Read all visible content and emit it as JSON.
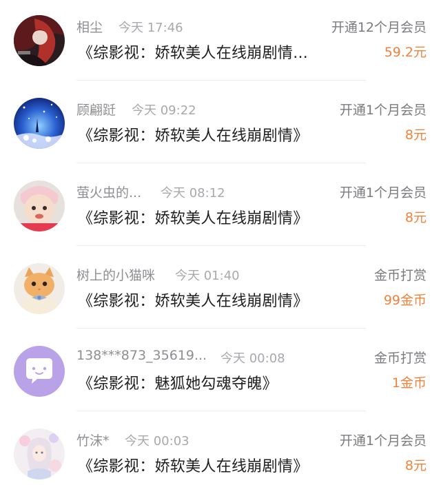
{
  "records": [
    {
      "user": "相尘",
      "time": "今天 17:46",
      "type": "开通12个月会员",
      "work": "《综影视：娇软美人在线崩剧情...",
      "amount": "59.2元",
      "avatar_icon": "dark-red-hair-anime-avatar"
    },
    {
      "user": "顾翩跹",
      "time": "今天 09:22",
      "type": "开通1个月会员",
      "work": "《综影视：娇软美人在线崩剧情》",
      "amount": "8元",
      "avatar_icon": "blue-starry-night-avatar"
    },
    {
      "user": "萤火虫的...",
      "time": "今天 08:12",
      "type": "开通1个月会员",
      "work": "《综影视：娇软美人在线崩剧情》",
      "amount": "8元",
      "avatar_icon": "baby-photo-avatar"
    },
    {
      "user": "树上的小猫咪",
      "time": "今天 01:40",
      "type": "金币打赏",
      "work": "《综影视：娇软美人在线崩剧情》",
      "amount": "99金币",
      "avatar_icon": "orange-cat-bowtie-avatar"
    },
    {
      "user": "138***873_35619...",
      "time": "今天 00:08",
      "type": "金币打赏",
      "work": "《综影视：魅狐她勾魂夺魄》",
      "amount": "1金币",
      "avatar_icon": "purple-chat-bubble-avatar"
    },
    {
      "user": "竹沫*",
      "time": "今天 00:03",
      "type": "开通1个月会员",
      "work": "《综影视：娇软美人在线崩剧情》",
      "amount": "8元",
      "avatar_icon": "pastel-floral-girl-avatar"
    }
  ],
  "colors": {
    "amount": "#f0823c",
    "name": "#8e8e93",
    "title": "#1f1f1f"
  }
}
